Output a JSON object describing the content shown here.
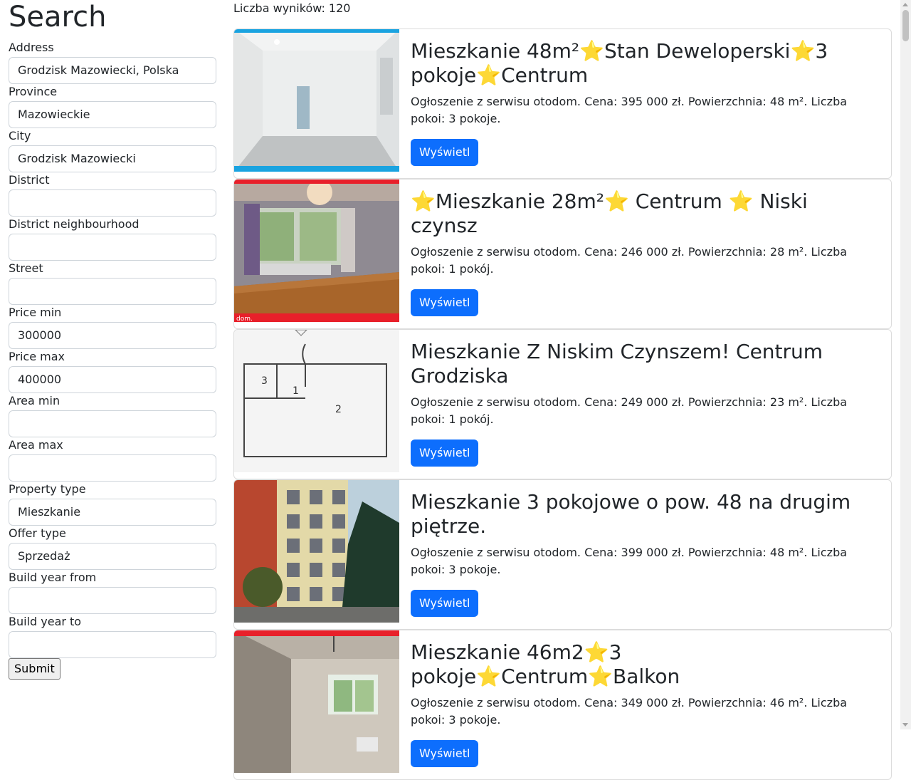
{
  "sidebar": {
    "title": "Search",
    "fields": [
      {
        "label": "Address",
        "value": "Grodzisk Mazowiecki, Polska"
      },
      {
        "label": "Province",
        "value": "Mazowieckie"
      },
      {
        "label": "City",
        "value": "Grodzisk Mazowiecki"
      },
      {
        "label": "District",
        "value": ""
      },
      {
        "label": "District neighbourhood",
        "value": ""
      },
      {
        "label": "Street",
        "value": ""
      },
      {
        "label": "Price min",
        "value": "300000"
      },
      {
        "label": "Price max",
        "value": "400000"
      },
      {
        "label": "Area min",
        "value": ""
      },
      {
        "label": "Area max",
        "value": ""
      },
      {
        "label": "Property type",
        "value": "Mieszkanie"
      },
      {
        "label": "Offer type",
        "value": "Sprzedaż"
      },
      {
        "label": "Build year from",
        "value": ""
      },
      {
        "label": "Build year to",
        "value": ""
      }
    ],
    "submit_label": "Submit"
  },
  "results": {
    "count_text": "Liczba wyników: 120",
    "button_label": "Wyświetl",
    "listings": [
      {
        "title": "Mieszkanie 48m²⭐Stan Deweloperski⭐3 pokoje⭐Centrum",
        "description": "Ogłoszenie z serwisu otodom. Cena: 395 000 zł. Powierzchnia: 48 m². Liczba pokoi: 3 pokoje.",
        "thumb_scene": "empty-white-room",
        "thumb_accent": "#1aa3e0"
      },
      {
        "title": "⭐Mieszkanie 28m²⭐ Centrum ⭐ Niski czynsz",
        "description": "Ogłoszenie z serwisu otodom. Cena: 246 000 zł. Powierzchnia: 28 m². Liczba pokoi: 1 pokój.",
        "thumb_scene": "room-parquet-window",
        "thumb_accent": "#e8202a",
        "thumb_caption": "dom."
      },
      {
        "title": "Mieszkanie Z Niskim Czynszem! Centrum Grodziska",
        "description": "Ogłoszenie z serwisu otodom. Cena: 249 000 zł. Powierzchnia: 23 m². Liczba pokoi: 1 pokój.",
        "thumb_scene": "floor-plan",
        "thumb_accent": "#ffffff"
      },
      {
        "title": "Mieszkanie 3 pokojowe o pow. 48 na drugim piętrze.",
        "description": "Ogłoszenie z serwisu otodom. Cena: 399 000 zł. Powierzchnia: 48 m². Liczba pokoi: 3 pokoje.",
        "thumb_scene": "building-exterior",
        "thumb_accent": "#ffffff"
      },
      {
        "title": "Mieszkanie 46m2⭐3 pokoje⭐Centrum⭐Balkon",
        "description": "Ogłoszenie z serwisu otodom. Cena: 349 000 zł. Powierzchnia: 46 m². Liczba pokoi: 3 pokoje.",
        "thumb_scene": "room-window-radiator",
        "thumb_accent": "#e8202a"
      }
    ]
  }
}
